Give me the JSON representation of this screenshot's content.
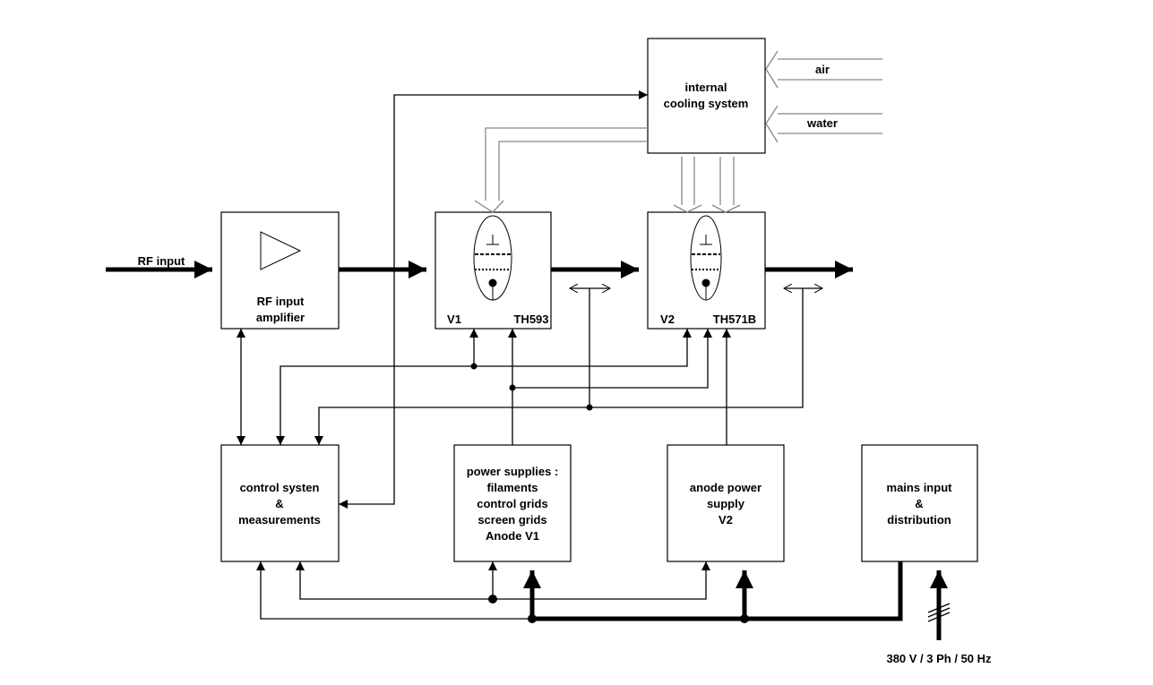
{
  "blocks": {
    "cooling": [
      "internal",
      "cooling system"
    ],
    "rf_amp": [
      "RF input",
      "amplifier"
    ],
    "v1": {
      "label": "V1",
      "type": "TH593"
    },
    "v2": {
      "label": "V2",
      "type": "TH571B"
    },
    "control": [
      "control systen",
      "&",
      "measurements"
    ],
    "power": [
      "power supplies :",
      "filaments",
      "control  grids",
      "screen grids",
      "Anode V1"
    ],
    "anode": [
      "anode power",
      "supply",
      "V2"
    ],
    "mains": [
      "mains input",
      "&",
      "distribution"
    ]
  },
  "inputs": {
    "rf": "RF input",
    "air": "air",
    "water": "water",
    "mains": "380 V  / 3 Ph  / 50  Hz"
  },
  "colors": {
    "line": "#000000",
    "coolant_line": "#888888"
  }
}
